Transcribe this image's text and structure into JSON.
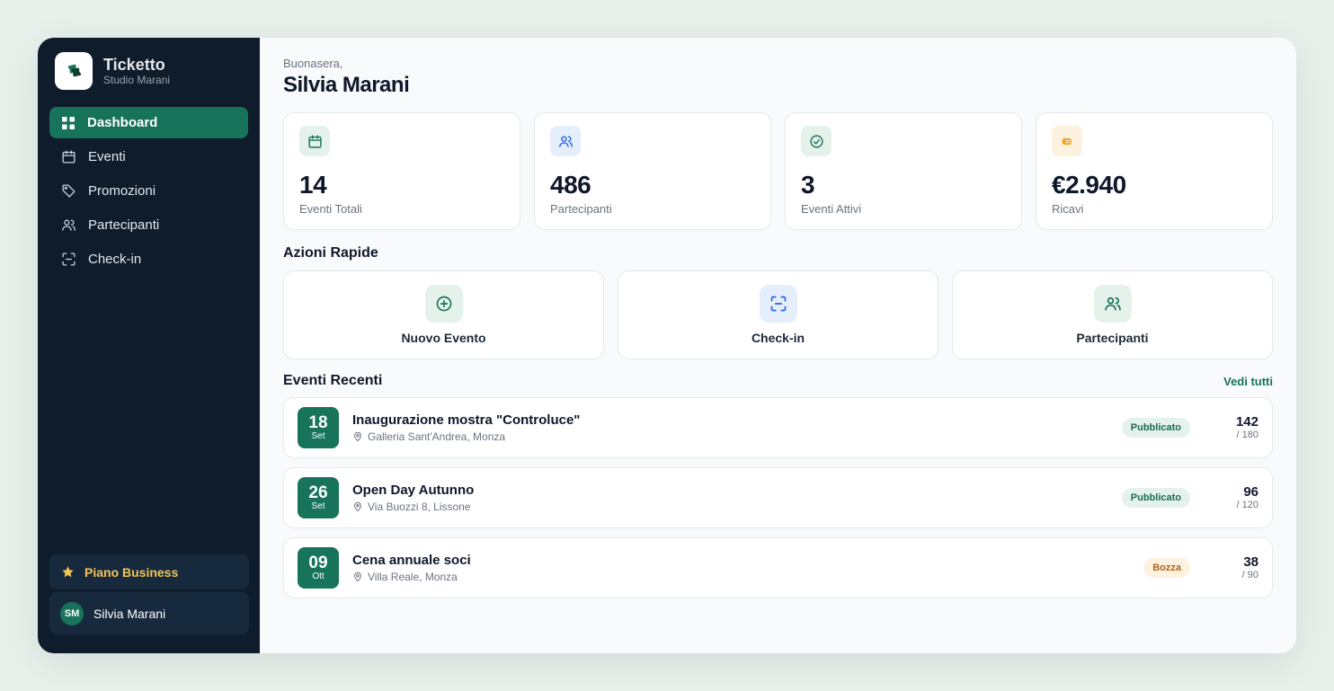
{
  "brand": {
    "name": "Ticketto",
    "subtitle": "Studio Marani"
  },
  "sidebar": {
    "items": [
      {
        "label": "Dashboard",
        "icon": "grid-icon",
        "active": true
      },
      {
        "label": "Eventi",
        "icon": "calendar-icon"
      },
      {
        "label": "Promozioni",
        "icon": "tag-icon"
      },
      {
        "label": "Partecipanti",
        "icon": "users-icon"
      },
      {
        "label": "Check-in",
        "icon": "scan-icon"
      }
    ],
    "plan": "Piano Business",
    "user": {
      "initials": "SM",
      "name": "Silvia Marani"
    }
  },
  "header": {
    "greeting": "Buonasera,",
    "name": "Silvia Marani"
  },
  "stats": [
    {
      "value": "14",
      "label": "Eventi Totali",
      "icon": "calendar-icon",
      "color": "#17745a",
      "bg": "#e5f2ec"
    },
    {
      "value": "486",
      "label": "Partecipanti",
      "icon": "users-icon",
      "color": "#2563eb",
      "bg": "#e5eefb"
    },
    {
      "value": "3",
      "label": "Eventi Attivi",
      "icon": "check-circle-icon",
      "color": "#17745a",
      "bg": "#e5f2ec"
    },
    {
      "value": "€2.940",
      "label": "Ricavi",
      "icon": "wallet-icon",
      "color": "#d97706",
      "bg": "#fdf1e0"
    }
  ],
  "quick_actions": {
    "title": "Azioni Rapide",
    "items": [
      {
        "label": "Nuovo Evento",
        "icon": "plus-circle-icon"
      },
      {
        "label": "Check-in",
        "icon": "scan-icon"
      },
      {
        "label": "Partecipanti",
        "icon": "users-icon"
      }
    ]
  },
  "recent": {
    "title": "Eventi Recenti",
    "see_all": "Vedi tutti",
    "events": [
      {
        "day": "18",
        "month": "Set",
        "title": "Inaugurazione mostra \"Controluce\"",
        "place": "Galleria Sant'Andrea, Monza",
        "status": "Pubblicato",
        "count": "142",
        "capacity": "/ 180"
      },
      {
        "day": "26",
        "month": "Set",
        "title": "Open Day Autunno",
        "place": "Via Buozzi 8, Lissone",
        "status": "Pubblicato",
        "count": "96",
        "capacity": "/ 120"
      },
      {
        "day": "09",
        "month": "Ott",
        "title": "Cena annuale soci",
        "place": "Villa Reale, Monza",
        "status": "Bozza",
        "count": "38",
        "capacity": "/ 90"
      }
    ]
  }
}
